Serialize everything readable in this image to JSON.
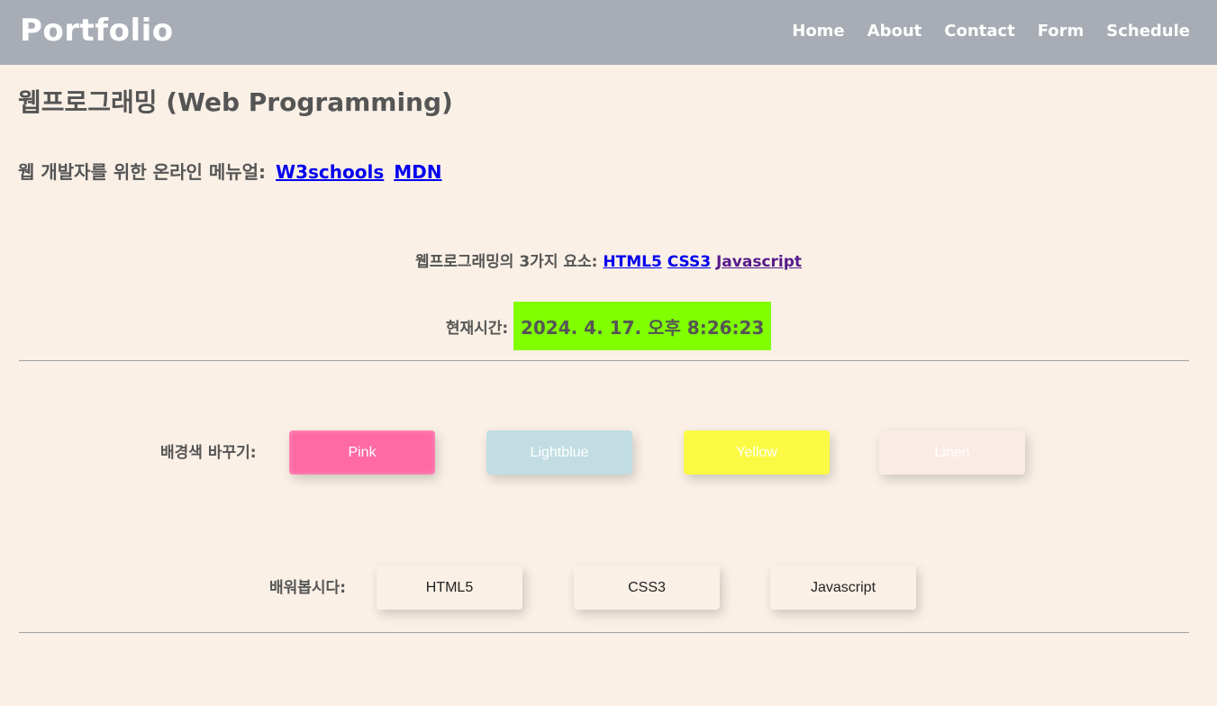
{
  "navbar": {
    "brand": "Portfolio",
    "links": [
      "Home",
      "About",
      "Contact",
      "Form",
      "Schedule"
    ]
  },
  "heading": "웹프로그래밍 (Web Programming)",
  "manual": {
    "label": "웹 개발자를 위한 온라인 메뉴얼:",
    "links": [
      "W3schools",
      "MDN"
    ]
  },
  "elements": {
    "label": "웹프로그래밍의 3가지 요소:",
    "links": [
      "HTML5",
      "CSS3",
      "Javascript"
    ]
  },
  "clock": {
    "label": "현재시간:",
    "value": "2024. 4. 17. 오후 8:26:23",
    "background": "#7fff00"
  },
  "bg_change": {
    "label": "배경색 바꾸기:",
    "buttons": [
      "Pink",
      "Lightblue",
      "Yellow",
      "Linen"
    ]
  },
  "learn": {
    "label": "배워봅시다:",
    "buttons": [
      "HTML5",
      "CSS3",
      "Javascript"
    ]
  },
  "colors": {
    "page_bg": "#faf0e6",
    "navbar_bg": "#a8acb4",
    "link": "#0000ee",
    "visited_link": "#551a8b",
    "pink": "#ff69a4",
    "lightblue": "#c2dde2",
    "yellow": "#fafa45",
    "linen": "#faebe4"
  }
}
